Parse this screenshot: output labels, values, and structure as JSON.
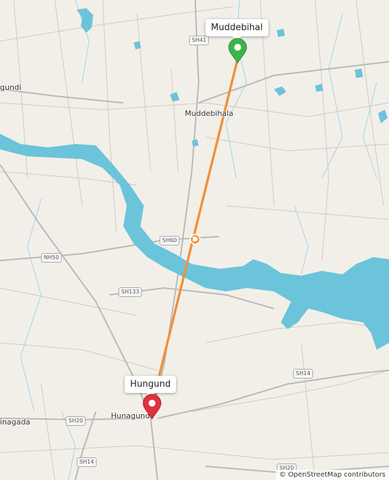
{
  "markers": {
    "origin": {
      "label": "Muddebihal",
      "color": "#3cb44b"
    },
    "destination": {
      "label": "Hungund",
      "color": "#e0323c"
    }
  },
  "place_labels": {
    "muddebihala": "Muddebihala",
    "hunagund": "Hunagund",
    "gundi_fragment": "gundi",
    "inagada_fragment": "inagada"
  },
  "road_shields": {
    "sh41": "SH41",
    "sh60": "SH60",
    "nh50": "NH50",
    "sh133": "SH133",
    "sh14_east": "SH14",
    "sh20": "SH20",
    "sh14_south": "SH14",
    "sh20_southeast": "SH20"
  },
  "route": {
    "color": "#f0913a",
    "fuel_icon": "fuel-station-icon"
  },
  "colors": {
    "water": "#6cc4da",
    "land": "#f2efe9",
    "road": "#b8b8b8"
  },
  "attribution": "© OpenStreetMap contributors"
}
